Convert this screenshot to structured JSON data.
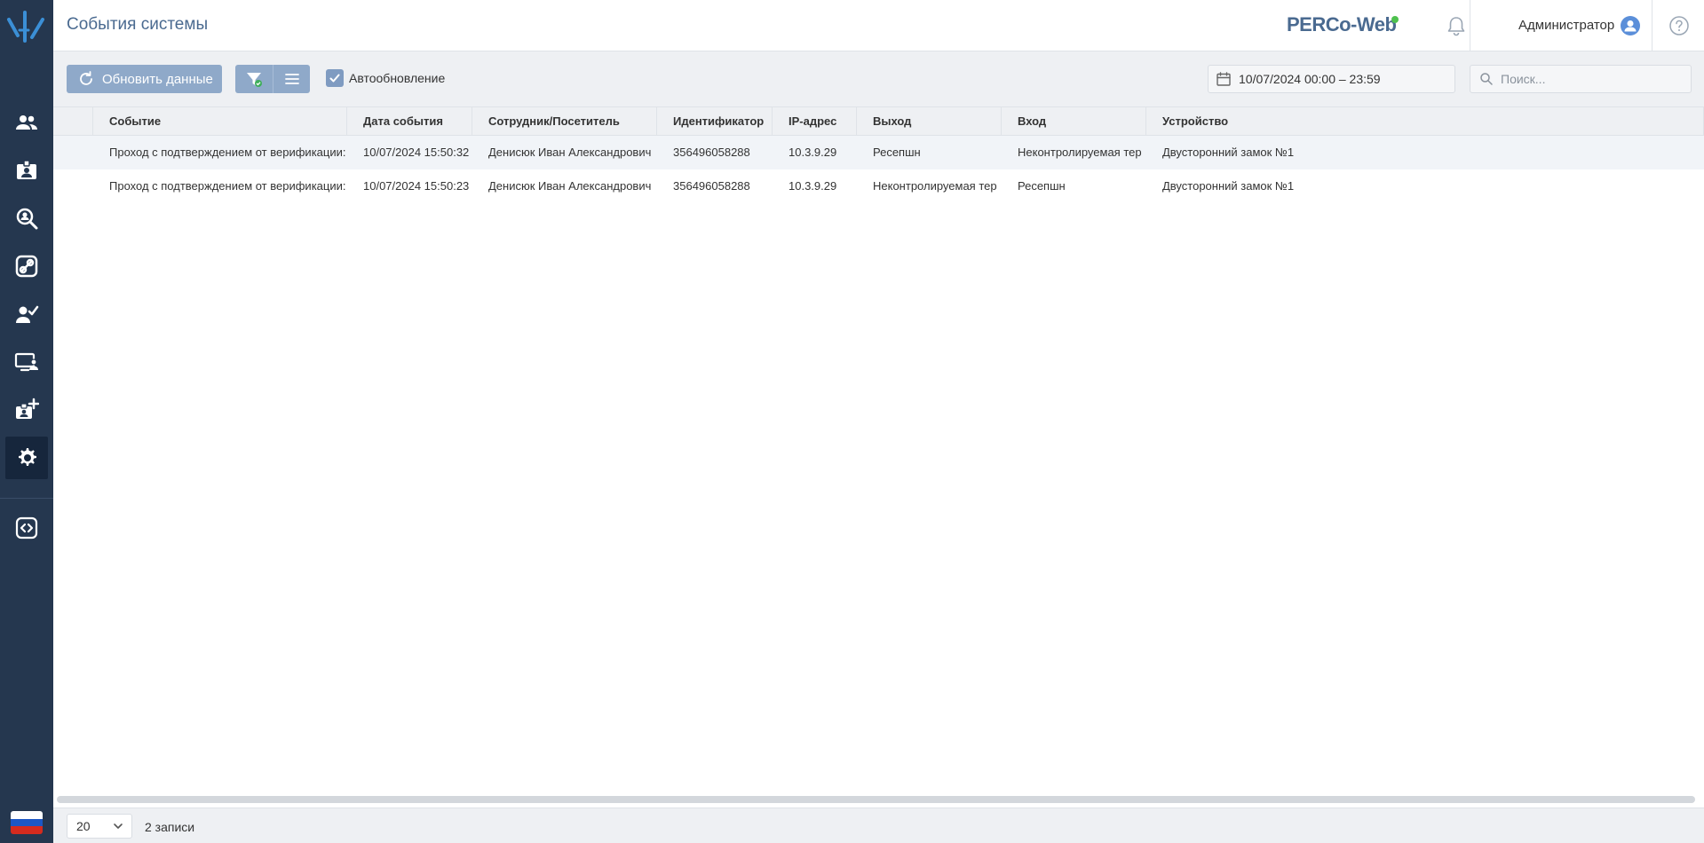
{
  "header": {
    "title": "События системы",
    "brand": "PERCo-Web",
    "user_name": "Администратор"
  },
  "sidebar": {
    "items": [
      {
        "icon": "users-icon"
      },
      {
        "icon": "id-card-icon"
      },
      {
        "icon": "visitor-search-icon"
      },
      {
        "icon": "access-key-icon"
      },
      {
        "icon": "user-check-icon"
      },
      {
        "icon": "monitoring-icon"
      },
      {
        "icon": "add-card-icon"
      },
      {
        "icon": "gear-icon",
        "active": true
      },
      {
        "icon": "code-icon"
      }
    ],
    "language_flag": "ru-flag-icon"
  },
  "toolbar": {
    "refresh_label": "Обновить данные",
    "auto_refresh_label": "Автообновление",
    "auto_refresh_checked": true,
    "date_range": "10/07/2024 00:00 – 23:59",
    "search_placeholder": "Поиск..."
  },
  "table": {
    "columns": [
      "Событие",
      "Дата события",
      "Сотрудник/Посетитель",
      "Идентификатор",
      "IP-адрес",
      "Выход",
      "Вход",
      "Устройство"
    ],
    "rows": [
      [
        "Проход с подтверждением от верификации:",
        "10/07/2024 15:50:32",
        "Денисюк Иван Александрович",
        "356496058288",
        "10.3.9.29",
        "Ресепшн",
        "Неконтролируемая тер",
        "Двусторонний замок №1"
      ],
      [
        "Проход с подтверждением от верификации:",
        "10/07/2024 15:50:23",
        "Денисюк Иван Александрович",
        "356496058288",
        "10.3.9.29",
        "Неконтролируемая тер",
        "Ресепшн",
        "Двусторонний замок №1"
      ]
    ]
  },
  "footer": {
    "page_size": "20",
    "record_count": "2 записи"
  },
  "colors": {
    "sidebar_bg": "#25374f",
    "accent": "#4a6a90",
    "button_bg": "#8fa9c9",
    "status_online": "#4ec14e"
  }
}
